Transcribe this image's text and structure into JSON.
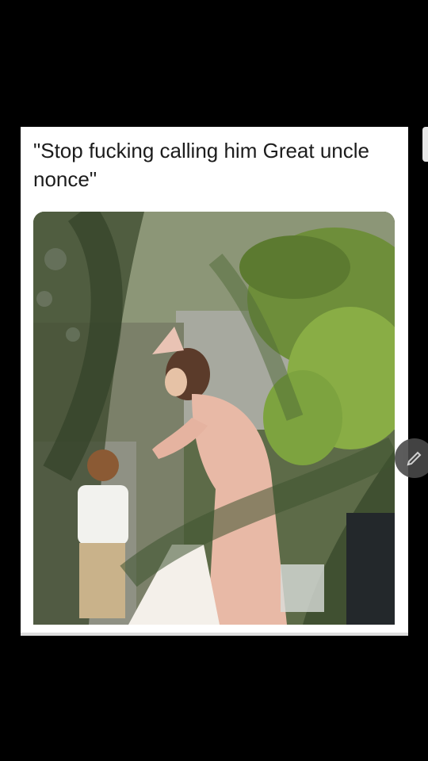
{
  "post": {
    "caption": "\"Stop fucking calling him Great uncle nonce\""
  },
  "photo": {
    "description_icon": "photo-image"
  },
  "controls": {
    "edit_icon": "pencil-icon"
  },
  "colors": {
    "background": "#000000",
    "card": "#ffffff",
    "caption_text": "#1c1c1c",
    "fab": "#4a4a4a"
  }
}
